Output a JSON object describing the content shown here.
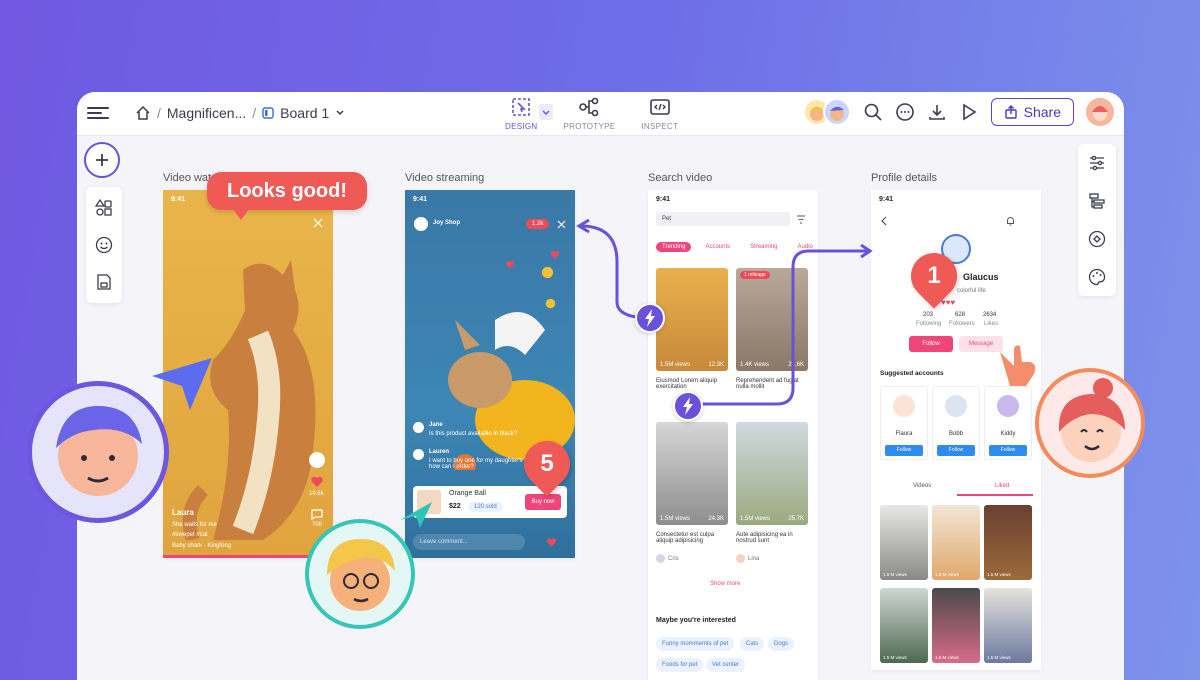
{
  "breadcrumb": {
    "project": "Magnificen...",
    "board": "Board 1"
  },
  "modes": [
    {
      "label": "DESIGN"
    },
    {
      "label": "PROTOTYPE"
    },
    {
      "label": "INSPECT"
    }
  ],
  "share_label": "Share",
  "colors": {
    "accent": "#6a51d9",
    "pink": "#f0457a",
    "red": "#ef5a56",
    "blue": "#4aa3f0"
  },
  "frames": {
    "video_watch": {
      "label": "Video wat",
      "time": "9:41",
      "user": "Laura",
      "caption": "She waits for me",
      "tags": "#lovepet  #cat",
      "music": "Baby shark - Kingfong",
      "likes": "19.6k",
      "comments": "700"
    },
    "video_streaming": {
      "label": "Video streaming",
      "time": "9:41",
      "shop": "Joy Shop",
      "live_count": "1.2k",
      "comments": [
        {
          "name": "Jane",
          "text": "Is this product available in black?"
        },
        {
          "name": "Lauren",
          "text": "I want to buy one for my daughter's birthday, how can I order?"
        }
      ],
      "product": {
        "name": "Orange Ball",
        "price": "$22",
        "sold": "120 sold",
        "buy": "Buy now"
      },
      "comment_placeholder": "Leave comment..."
    },
    "search_video": {
      "label": "Search video",
      "time": "9:41",
      "query": "Pet",
      "tabs": [
        "Trending",
        "Accounts",
        "Streaming",
        "Audio"
      ],
      "cards": [
        {
          "views": "1.5M views",
          "likes": "12.3K",
          "title": "Eiusmod Lorem aliquip exercitation",
          "badge": ""
        },
        {
          "views": "1.4K views",
          "likes": "25.6K",
          "title": "Reprehenderit ad fugiat nulla mollit",
          "badge": "1 mileage"
        },
        {
          "views": "1.5M views",
          "likes": "24.3K",
          "title": "Consectetur est culpa aliquip adipisicing",
          "author": "Cris"
        },
        {
          "views": "1.5M views",
          "likes": "25.7K",
          "title": "Aute adipisicing ea in nostrud sunt",
          "author": "Lina"
        }
      ],
      "show_more": "Show more",
      "interest_title": "Maybe you're interested",
      "chips": [
        "Funny mommemts of pet",
        "Cats",
        "Dogs",
        "Foods for pet",
        "Vet center"
      ]
    },
    "profile": {
      "label": "Profile details",
      "time": "9:41",
      "name": "Glaucus",
      "bio": "colorful life",
      "stats": [
        {
          "v": "203",
          "k": "Following"
        },
        {
          "v": "628",
          "k": "Followers"
        },
        {
          "v": "2634",
          "k": "Likes"
        }
      ],
      "follow": "Follow",
      "message": "Message",
      "suggested_title": "Suggested accounts",
      "suggested": [
        {
          "name": "Flaura",
          "btn": "Follow"
        },
        {
          "name": "Bobb",
          "btn": "Follow"
        },
        {
          "name": "Kiddy",
          "btn": "Follow"
        }
      ],
      "tabs": [
        "Videos",
        "Liked"
      ],
      "grid_views": [
        "1.5 M views",
        "1.5 M views",
        "1.5 M views",
        "1.5 M views",
        "1.5 M views",
        "1.5 M views"
      ]
    }
  },
  "overlays": {
    "bubble": "Looks good!",
    "pin_one": "1",
    "pin_five": "5"
  },
  "icons": [
    "hamburger-icon",
    "home-icon",
    "board-icon",
    "chevron-down-icon",
    "design-icon",
    "prototype-icon",
    "inspect-icon",
    "search-icon",
    "comment-icon",
    "download-icon",
    "play-icon",
    "share-icon",
    "plus-icon",
    "components-icon",
    "emoji-icon",
    "save-icon",
    "settings-icon",
    "layers-icon",
    "plugin-icon",
    "palette-icon",
    "lightning-icon"
  ]
}
